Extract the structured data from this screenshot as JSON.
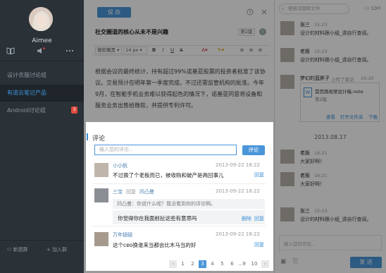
{
  "sidebar": {
    "username": "Aimee",
    "groups": [
      {
        "label": "设计衣服讨论组",
        "active": false
      },
      {
        "label": "有道云笔记产品",
        "active": true
      },
      {
        "label": "Android讨论组",
        "active": false,
        "badge": "3"
      }
    ],
    "new_group_label": "新建群",
    "join_group_label": "加入群"
  },
  "editor": {
    "save_label": "保 存",
    "title": "社交圈道的核心从未不是兴趣",
    "group_chip": "第2版",
    "font_family": "微软雅黑",
    "font_size": "14 px",
    "body": "根据会议的最终统计，持有超过99%诺基亚股票的投资者批准了该协议。交易预计在明年第一季度完成，不过还需监管机构的批准。今年9月，在智能手机业务难以获得起色的情况下，诺基亚同意将设备和服务业务出售给微软，并提供专利许可。"
  },
  "comments": {
    "title": "评论",
    "input_placeholder": "输入您的评论..",
    "submit_label": "评论",
    "items": [
      {
        "name": "小小帆",
        "time": "2013-09-22 18:22",
        "text": "不过换了个老板而已，被收购和破产是两回事儿",
        "action": "回复"
      },
      {
        "name": "三宝",
        "reply_word": "回复",
        "reply_to": "凹凸曼",
        "time": "2013-09-22 18:22",
        "quote": "凹凸曼：你说什么呢？我没看到你的评论啊。",
        "text": "你觉得你在我面前扯这些有意思吗",
        "delete": "删除",
        "action": "回复"
      },
      {
        "name": "万年翅翅",
        "time": "2013-09-22 18:22",
        "text": "这个ceo换谁来当都会比木马当的好",
        "action": "回复"
      }
    ],
    "pages": [
      "1",
      "2",
      "3",
      "4",
      "5",
      "6",
      "...",
      "9",
      "10"
    ],
    "current_page": "3",
    "prev": "‹",
    "next": "›"
  },
  "chat": {
    "search_placeholder": "搜索话题和文件",
    "member_count": "10",
    "messages": [
      {
        "name": "张三",
        "time": "15:23",
        "text": "设计的材料跟小组_请自行查阅。"
      },
      {
        "name": "老板",
        "time": "15:23",
        "text": "设计的材料跟小组_请自行查阅。"
      },
      {
        "name": "梦幻的蓝胖子",
        "action": "上传了笔记",
        "time": "16:20"
      },
      {
        "name": "老板",
        "time": "16:21",
        "text": "大家好啊！"
      },
      {
        "name": "老板",
        "time": "16:21",
        "text": "大家好啊！"
      },
      {
        "name": "张三",
        "time": "15:23",
        "text": "设计的材料跟小组_请自行查阅。"
      }
    ],
    "file_name": "首页跑视觉设计稿.note",
    "file_group": "第2版",
    "file_view": "查看",
    "file_open": "打开文件夹",
    "file_download": "下载",
    "date_divider": "2013.08.17",
    "input_placeholder": "输入您的评论...",
    "send_label": "发 送"
  }
}
